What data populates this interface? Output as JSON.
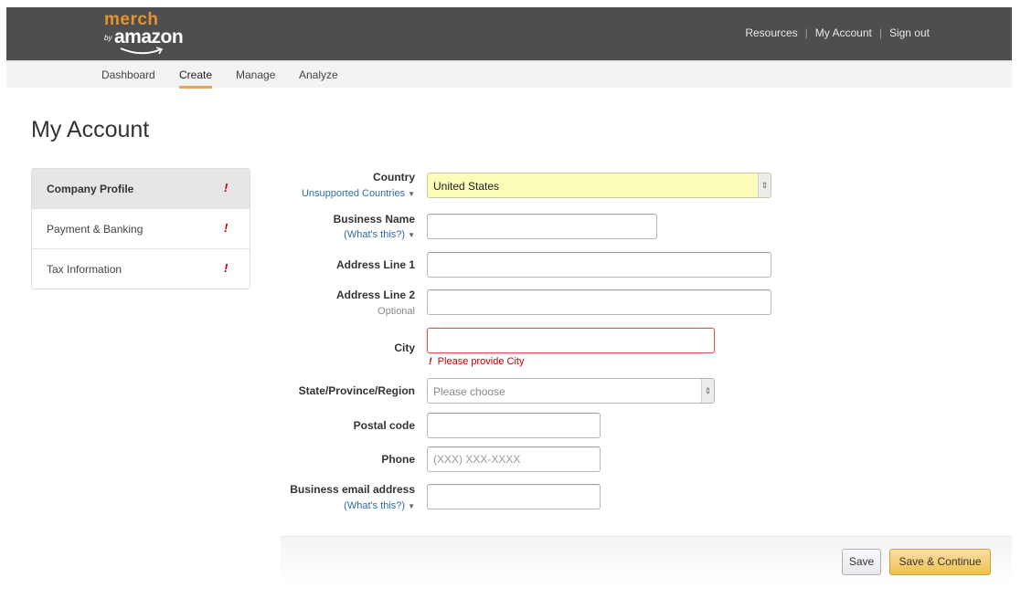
{
  "header": {
    "logo": {
      "top": "merch",
      "by": "by",
      "brand": "amazon"
    },
    "links": [
      {
        "label": "Resources"
      },
      {
        "label": "My Account"
      },
      {
        "label": "Sign out"
      }
    ]
  },
  "nav": {
    "tabs": [
      {
        "label": "Dashboard",
        "active": false
      },
      {
        "label": "Create",
        "active": true
      },
      {
        "label": "Manage",
        "active": false
      },
      {
        "label": "Analyze",
        "active": false
      }
    ]
  },
  "page": {
    "title": "My Account"
  },
  "sidebar": {
    "items": [
      {
        "label": "Company Profile",
        "active": true,
        "alert": "!"
      },
      {
        "label": "Payment & Banking",
        "active": false,
        "alert": "!"
      },
      {
        "label": "Tax Information",
        "active": false,
        "alert": "!"
      }
    ]
  },
  "form": {
    "country": {
      "label": "Country",
      "sub": "Unsupported Countries",
      "value": "United States"
    },
    "business_name": {
      "label": "Business Name",
      "sub": "(What's this?)",
      "value": ""
    },
    "address1": {
      "label": "Address Line 1",
      "value": ""
    },
    "address2": {
      "label": "Address Line 2",
      "sub": "Optional",
      "value": ""
    },
    "city": {
      "label": "City",
      "value": "",
      "error": "Please provide City",
      "error_mark": "!"
    },
    "state": {
      "label": "State/Province/Region",
      "placeholder": "Please choose"
    },
    "postal": {
      "label": "Postal code",
      "value": ""
    },
    "phone": {
      "label": "Phone",
      "placeholder": "(XXX) XXX-XXXX",
      "value": ""
    },
    "email": {
      "label": "Business email address",
      "sub": "(What's this?)",
      "value": ""
    }
  },
  "actions": {
    "save": "Save",
    "save_continue": "Save & Continue"
  },
  "colors": {
    "header_bg": "#4d4e50",
    "logo_orange": "#e6932b",
    "active_tab_underline": "#e6a75a",
    "error_red": "#c40000",
    "country_highlight": "#fafcb8",
    "primary_button": "#f0c14b",
    "link_blue": "#2e6da4"
  }
}
